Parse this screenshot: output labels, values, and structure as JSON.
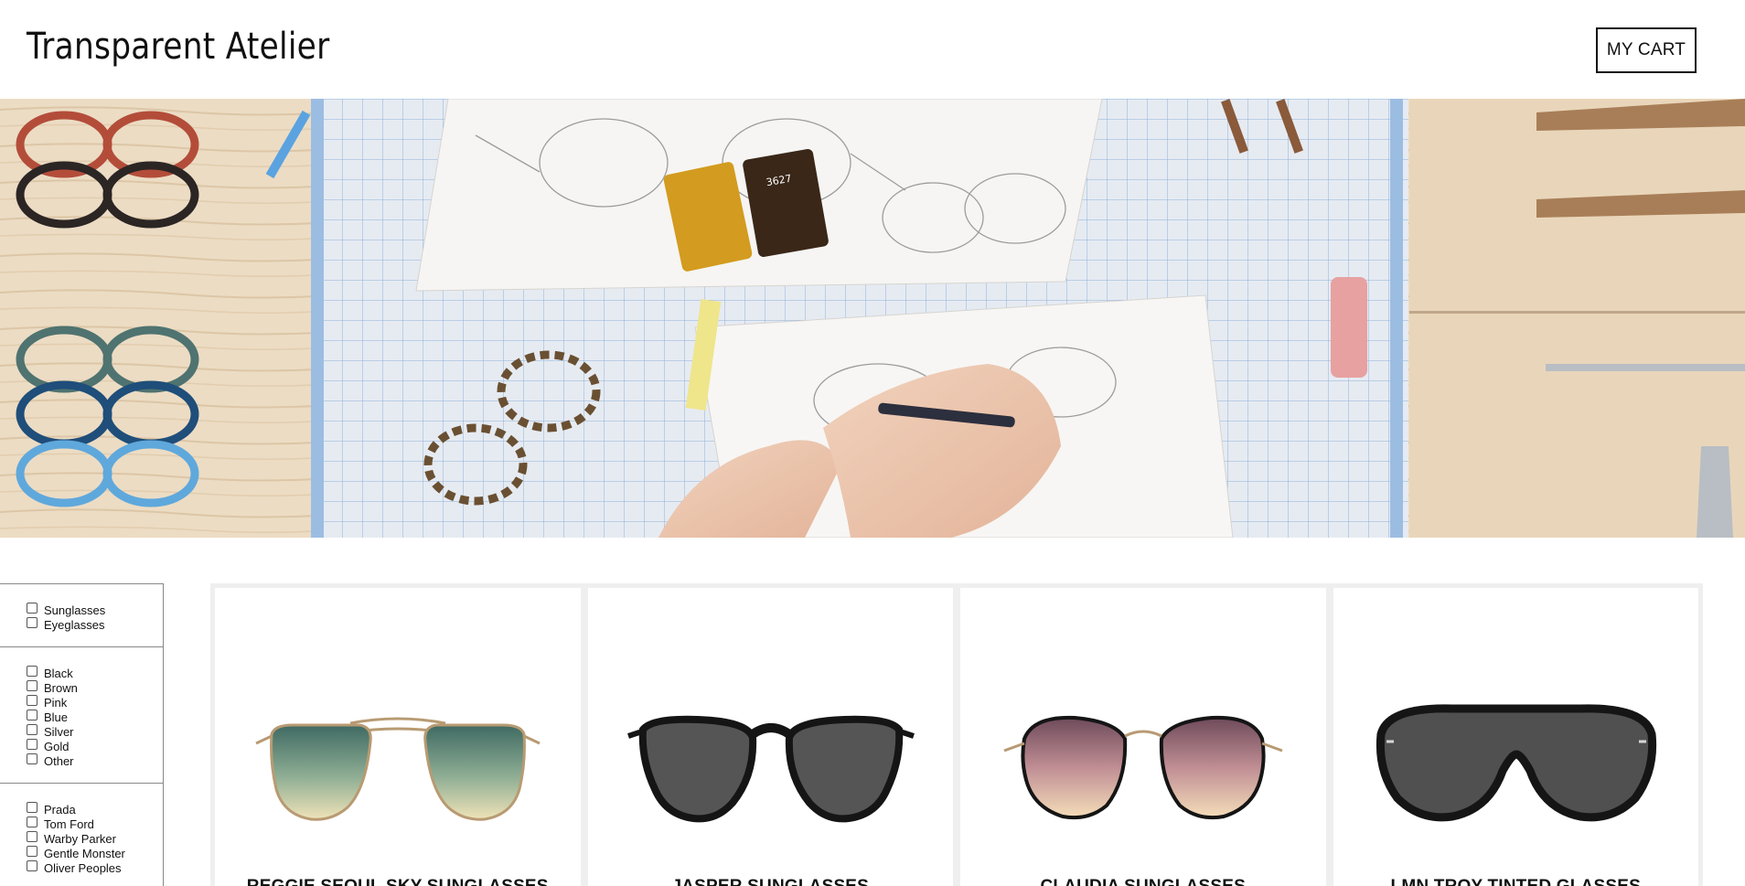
{
  "header": {
    "brand": "Transparent Atelier",
    "cart_label": "MY CART"
  },
  "hero": {
    "image_alt": "Eyewear design workbench with sketches"
  },
  "filters": {
    "type": [
      "Sunglasses",
      "Eyeglasses"
    ],
    "color": [
      "Black",
      "Brown",
      "Pink",
      "Blue",
      "Silver",
      "Gold",
      "Other"
    ],
    "brand": [
      "Prada",
      "Tom Ford",
      "Warby Parker",
      "Gentle Monster",
      "Oliver Peoples"
    ]
  },
  "products": [
    {
      "name": "REGGIE SEOUL SKY SUNGLASSES"
    },
    {
      "name": "JASPER SUNGLASSES"
    },
    {
      "name": "CLAUDIA SUNGLASSES"
    },
    {
      "name": "LMN TROY TINTED GLASSES"
    }
  ],
  "colors": {
    "lens_teal_top": "#3f6a63",
    "lens_teal_bottom": "#efe3b8",
    "lens_grey": "#545454",
    "lens_pink_top": "#6e4a5a",
    "lens_pink_bottom": "#f4ddb9",
    "frame_gold": "#b89a72",
    "frame_black": "#151515"
  }
}
